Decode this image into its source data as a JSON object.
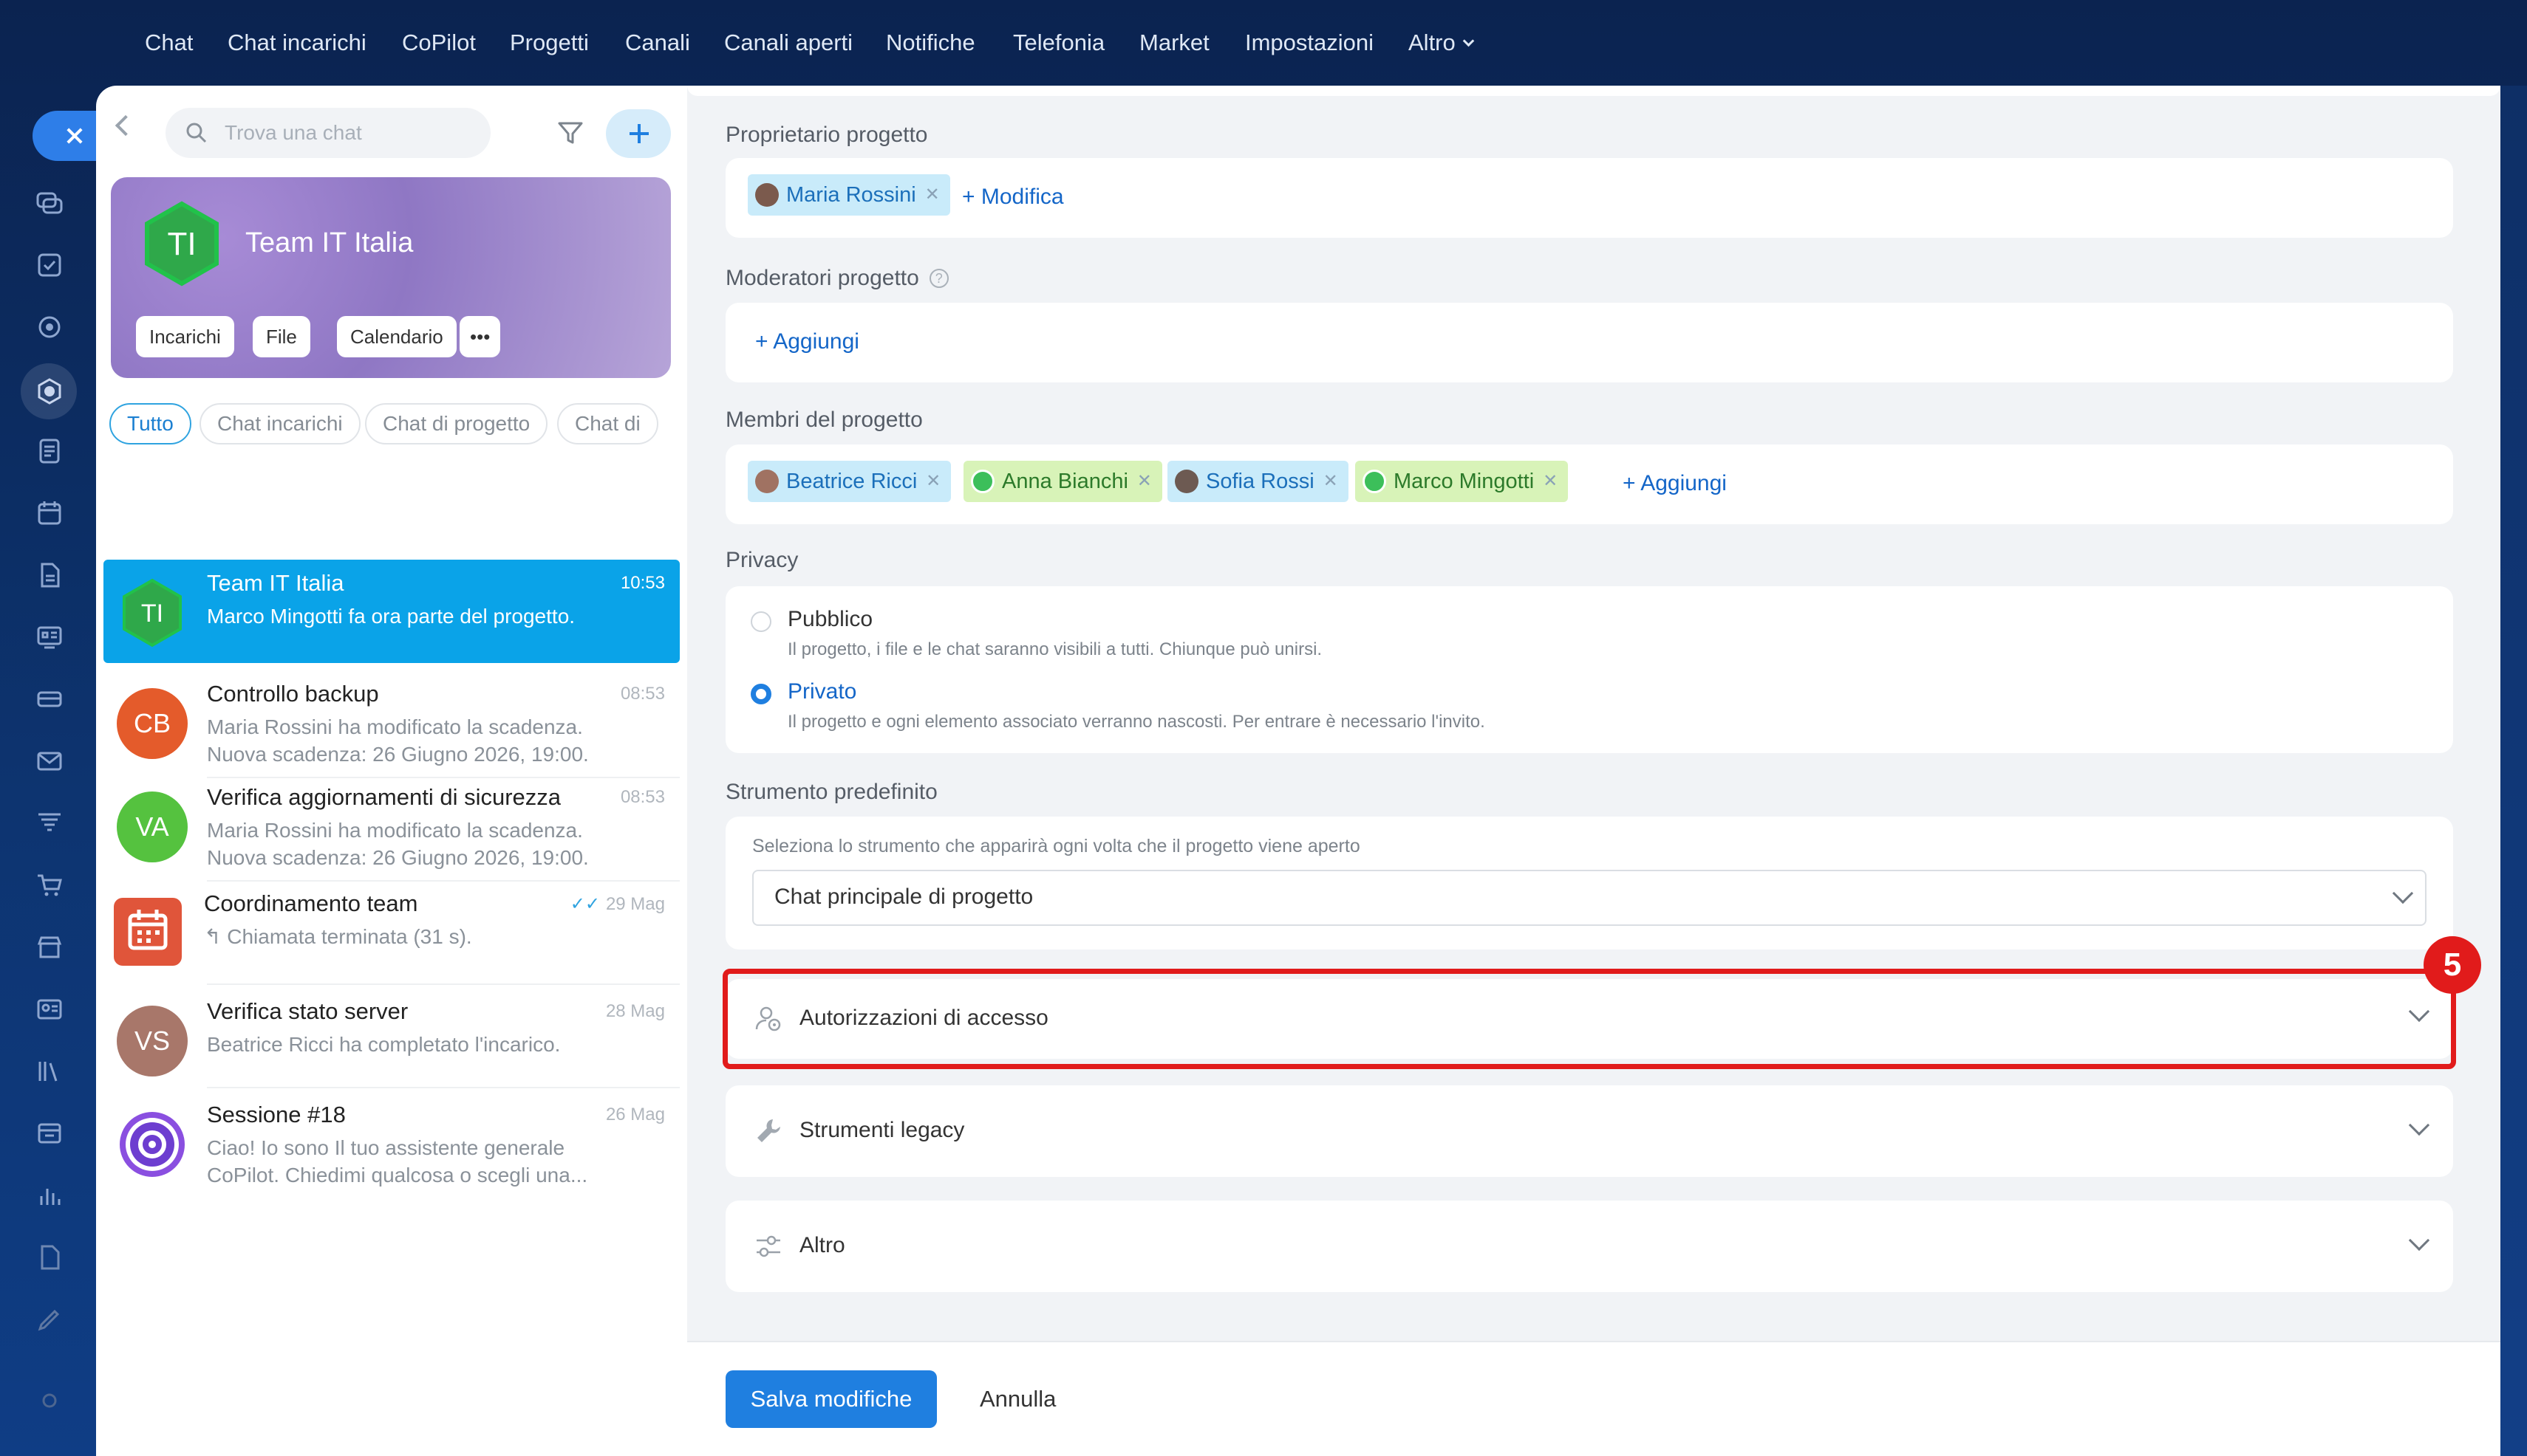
{
  "colors": {
    "accent": "#1f7fe0",
    "active_chat_bg": "#0aa3e8",
    "highlight_red": "#e11b1b",
    "tag_blue": "#c9ebfa",
    "tag_green": "#d8f3b8",
    "nav_bg": "#0b2350"
  },
  "topnav": {
    "items": [
      "Chat",
      "Chat incarichi",
      "CoPilot",
      "Progetti",
      "Canali",
      "Canali aperti",
      "Notifiche",
      "Telefonia",
      "Market",
      "Impostazioni",
      "Altro"
    ]
  },
  "rail": {
    "icons": [
      "chat-icon",
      "tasks-icon",
      "copilot-icon",
      "projects-icon",
      "feed-icon",
      "calendar-icon",
      "document-icon",
      "board-icon",
      "drive-icon",
      "mail-icon",
      "funnel-icon",
      "cart-icon",
      "store-icon",
      "contacts-icon",
      "library-icon",
      "workflow-icon",
      "analytics-icon",
      "forms-icon",
      "sign-icon"
    ]
  },
  "left": {
    "search_placeholder": "Trova una chat",
    "team": {
      "initials": "TI",
      "name": "Team IT Italia",
      "buttons": [
        "Incarichi",
        "File",
        "Calendario",
        "•••"
      ]
    },
    "filters": [
      "Tutto",
      "Chat incarichi",
      "Chat di progetto",
      "Chat di"
    ],
    "chats": [
      {
        "initials": "TI",
        "title": "Team IT Italia",
        "time": "10:53",
        "preview": "Marco Mingotti fa ora parte del progetto.",
        "color": "#3cb54a"
      },
      {
        "initials": "CB",
        "title": "Controllo backup",
        "time": "08:53",
        "preview": "Maria Rossini ha modificato la scadenza. Nuova scadenza: 26 Giugno 2026, 19:00.",
        "color": "#e45b2b"
      },
      {
        "initials": "VA",
        "title": "Verifica aggiornamenti di sicurezza",
        "time": "08:53",
        "preview": "Maria Rossini ha modificato la scadenza. Nuova scadenza: 26 Giugno 2026, 19:00.",
        "color": "#55c23f"
      },
      {
        "initials": "",
        "title": "Coordinamento team",
        "time": "29 Mag",
        "preview": "↰ Chiamata terminata (31 s).",
        "color": "#e0553a"
      },
      {
        "initials": "VS",
        "title": "Verifica stato server",
        "time": "28 Mag",
        "preview": "Beatrice Ricci ha completato l'incarico.",
        "color": "#a8776a"
      },
      {
        "initials": "",
        "title": "Sessione #18",
        "time": "26 Mag",
        "preview": "Ciao! Io sono Il tuo assistente generale CoPilot. Chiedimi qualcosa o scegli una...",
        "color": "#7a3fd6"
      }
    ]
  },
  "main": {
    "owner": {
      "label": "Proprietario progetto",
      "people": [
        "Maria Rossini"
      ],
      "link": "+ Modifica"
    },
    "moderators": {
      "label": "Moderatori progetto",
      "info": "?",
      "link": "+ Aggiungi"
    },
    "members": {
      "label": "Membri del progetto",
      "people": [
        "Beatrice Ricci",
        "Anna Bianchi",
        "Sofia Rossi",
        "Marco Mingotti"
      ],
      "link": "+ Aggiungi"
    },
    "privacy": {
      "label": "Privacy",
      "options": [
        {
          "title": "Pubblico",
          "desc": "Il progetto, i file e le chat saranno visibili a tutti. Chiunque può unirsi.",
          "selected": false
        },
        {
          "title": "Privato",
          "desc": "Il progetto e ogni elemento associato verranno nascosti. Per entrare è necessario l'invito.",
          "selected": true
        }
      ]
    },
    "tool": {
      "label": "Strumento predefinito",
      "hint": "Seleziona lo strumento che apparirà ogni volta che il progetto viene aperto",
      "value": "Chat principale di progetto"
    },
    "accordions": [
      "Autorizzazioni di accesso",
      "Strumenti legacy",
      "Altro"
    ],
    "step_badge": "5",
    "footer": {
      "save": "Salva modifiche",
      "cancel": "Annulla"
    }
  }
}
